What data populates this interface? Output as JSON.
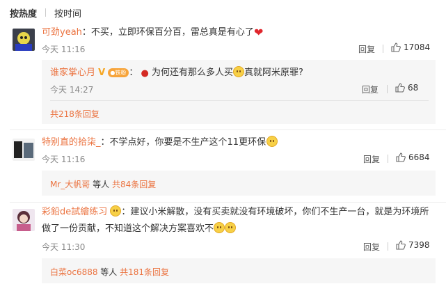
{
  "tabs": {
    "hot": "按热度",
    "time": "按时间"
  },
  "comments": [
    {
      "user": "可劲yeah",
      "text": "不买，立即环保百分百，雷总真是有心了",
      "time": "今天 11:16",
      "reply": "回复",
      "likes": "17084",
      "sub_reply": {
        "user": "谁家掌心月",
        "badge": "铁粉",
        "text_a": "为何还有那么多人买",
        "text_b": "真就阿米原罪?",
        "time": "今天 14:27",
        "reply": "回复",
        "likes": "68"
      },
      "more": "共218条回复"
    },
    {
      "user": "特别直的拾柒_",
      "text": "不学点好，你要是不生产这个11更环保",
      "time": "今天 11:16",
      "reply": "回复",
      "likes": "6684",
      "more_user": "Mr_大帆哥",
      "more_mid": " 等人 ",
      "more": "共84条回复"
    },
    {
      "user": "彩鉛de試繪练习",
      "text_line1": "建议小米解散，没有买卖就没有环境破坏，你们不生产一台，就是为环境所",
      "text_line2": "做了一份贡献，不知道这个解决方案喜欢不",
      "time": "今天 11:30",
      "reply": "回复",
      "likes": "7398",
      "more_user": "白菜oc6888",
      "more_mid": " 等人 ",
      "more": "共181条回复"
    }
  ],
  "icons": {
    "like": "thumbs-up-icon",
    "heart": "red-heart-emoji",
    "smile": "smile-emoji",
    "apple": "apple-emoji"
  },
  "colors": {
    "link": "#eb7340",
    "subbox": "#f6f6f6"
  }
}
